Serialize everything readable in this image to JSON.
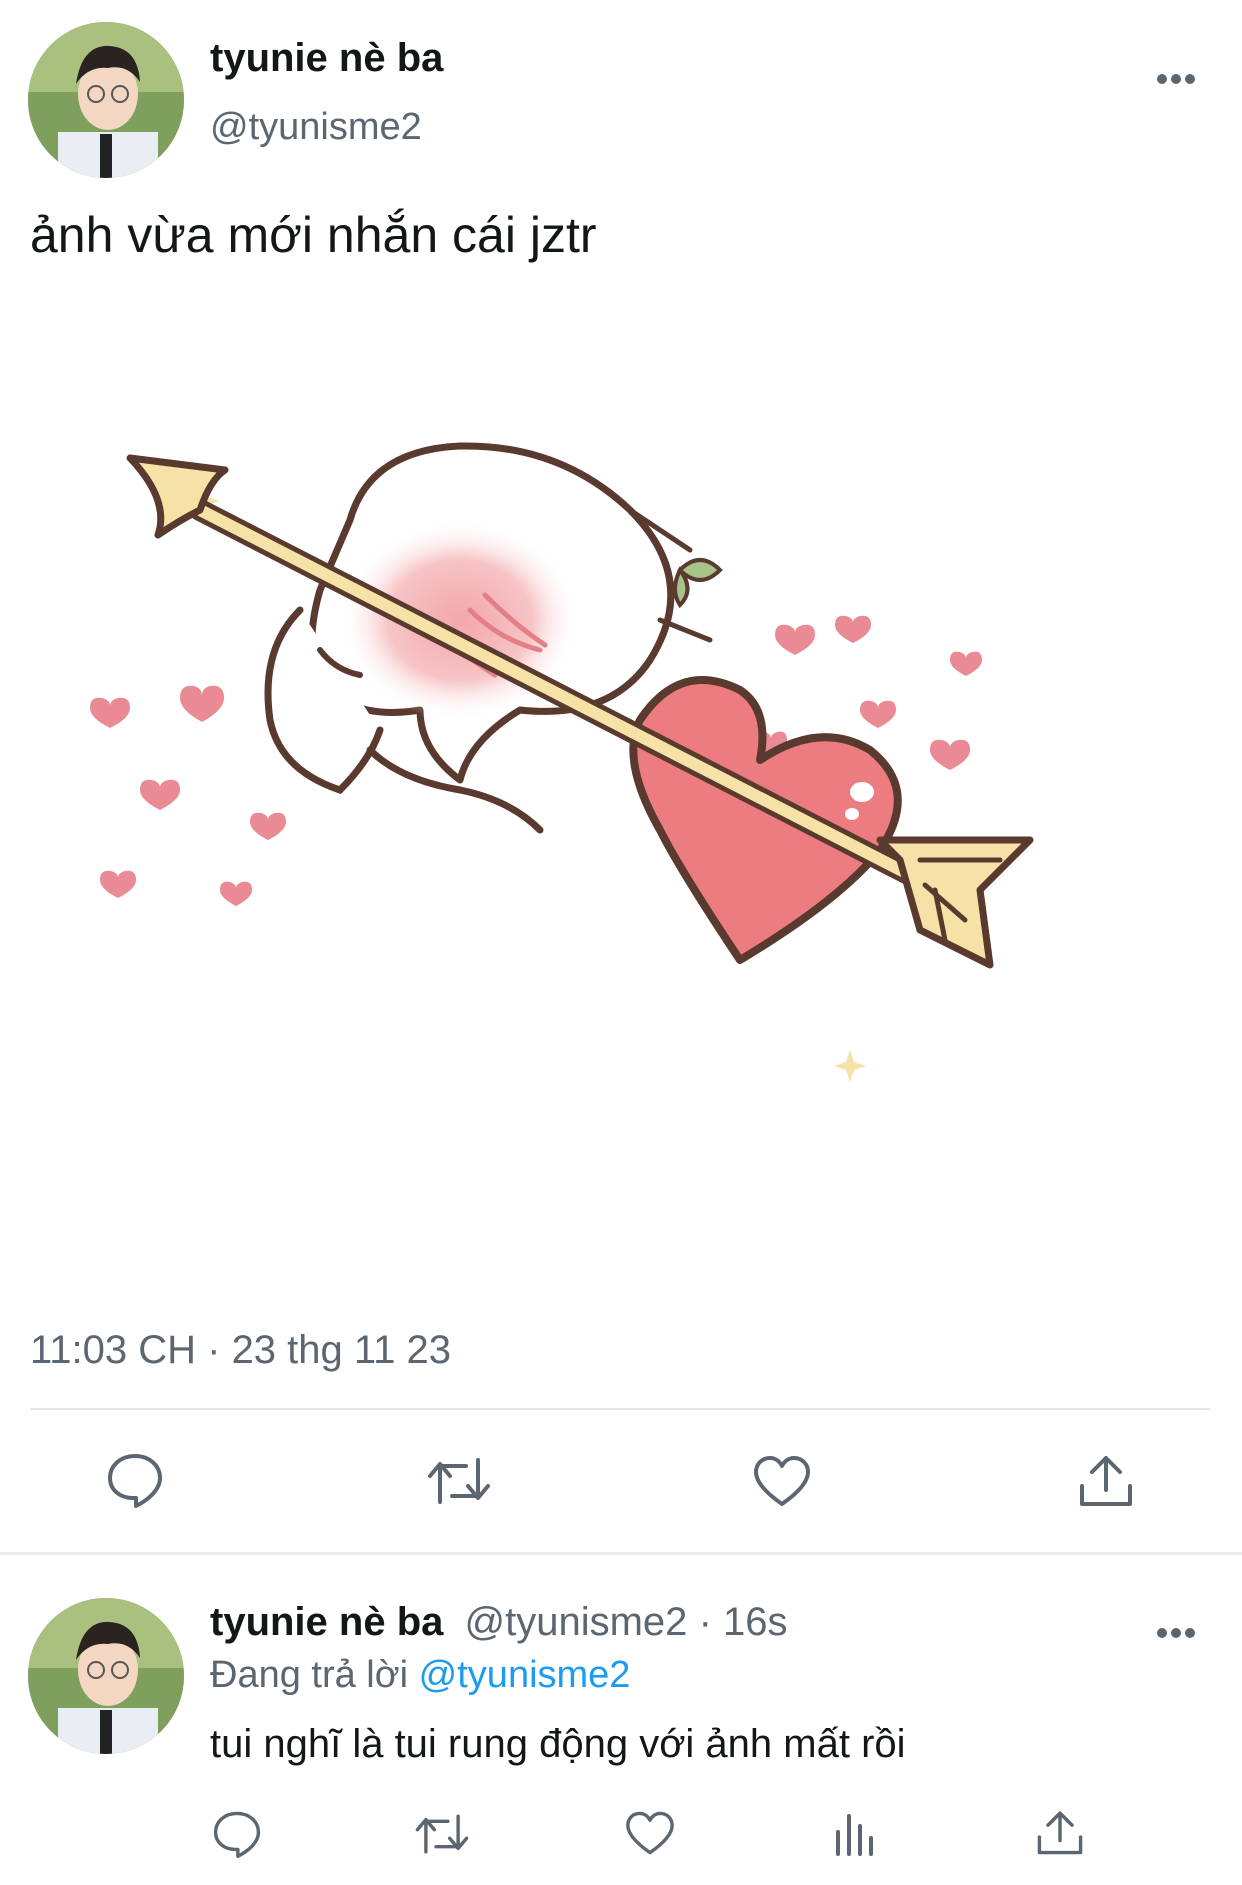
{
  "tweet": {
    "display_name": "tyunie nè ba",
    "handle": "@tyunisme2",
    "text": "ảnh vừa mới nhắn cái jztr",
    "more_icon": "ellipsis-icon",
    "image": "cupid-bun-with-arrow-through-heart-sticker",
    "timestamp": "11:03 CH · 23 thg 11 23",
    "actions": [
      "reply-icon",
      "retweet-icon",
      "like-icon",
      "share-icon"
    ]
  },
  "reply": {
    "display_name": "tyunie nè ba",
    "handle": "@tyunisme2",
    "separator": "·",
    "time": "16s",
    "replying_prefix": "Đang trả lời",
    "replying_handle": "@tyunisme2",
    "text": "tui nghĩ là tui rung động với ảnh mất rồi",
    "actions": [
      "reply-icon",
      "retweet-icon",
      "like-icon",
      "analytics-icon",
      "share-icon"
    ]
  },
  "colors": {
    "link": "#1d9bf0",
    "muted": "#5b6670",
    "divider": "#e1e8ed",
    "heart_pink": "#e8707a"
  }
}
